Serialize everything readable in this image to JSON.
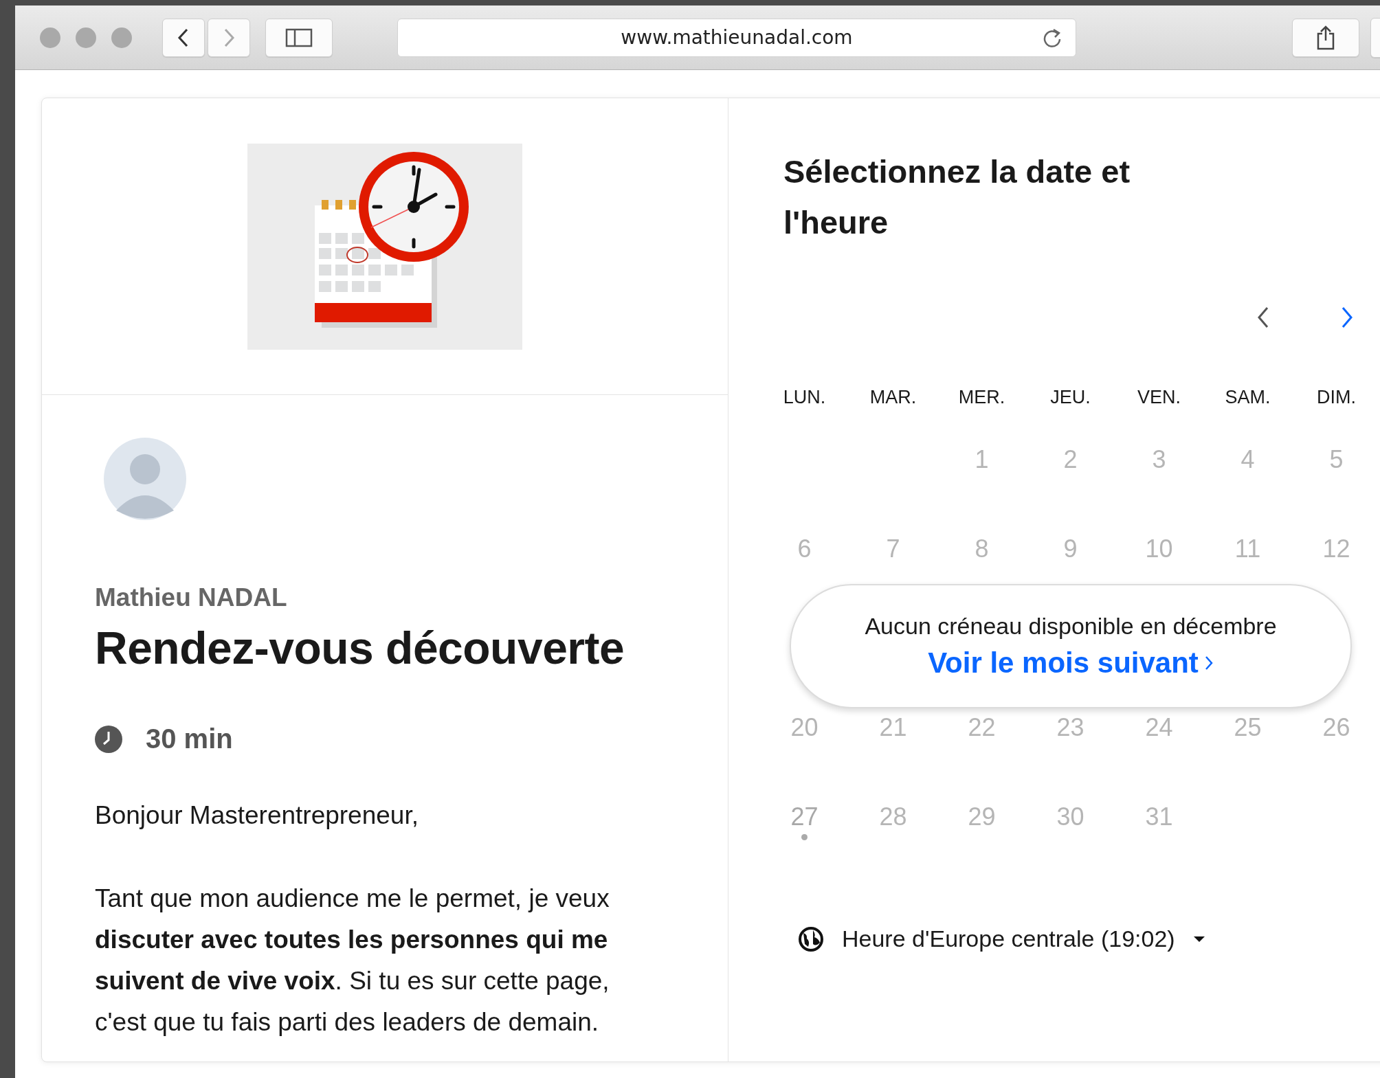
{
  "browser": {
    "address": "www.mathieunadal.com"
  },
  "event": {
    "host": "Mathieu NADAL",
    "title": "Rendez-vous découverte",
    "duration": "30 min",
    "greeting": "Bonjour Masterentrepreneur,",
    "description": "Tant que mon audience me le permet, je veux **discuter avec toutes les personnes qui me suivent de vive voix**. Si tu es sur cette page, c'est que tu fais parti des leaders de demain."
  },
  "calendar": {
    "heading": "Sélectionnez la date et l'heure",
    "prev": {
      "disabled": true
    },
    "next": {
      "disabled": false
    },
    "weekdays": [
      "LUN.",
      "MAR.",
      "MER.",
      "JEU.",
      "VEN.",
      "SAM.",
      "DIM."
    ],
    "weeks_before": [
      {
        "right_aligned": true,
        "days": [
          {
            "label": "1",
            "today": false
          },
          {
            "label": "2",
            "today": false
          },
          {
            "label": "3",
            "today": false
          },
          {
            "label": "4",
            "today": false
          },
          {
            "label": "5",
            "today": false
          }
        ]
      },
      {
        "days": [
          {
            "label": "6",
            "today": false
          },
          {
            "label": "7",
            "today": false
          },
          {
            "label": "8",
            "today": false
          },
          {
            "label": "9",
            "today": false
          },
          {
            "label": "10",
            "today": false
          },
          {
            "label": "11",
            "today": false
          },
          {
            "label": "12",
            "today": false
          }
        ]
      }
    ],
    "notice": {
      "message": "Aucun créneau disponible en décembre",
      "link": "Voir le mois suivant"
    },
    "weeks_after": [
      {
        "days": [
          {
            "label": "20",
            "today": false
          },
          {
            "label": "21",
            "today": false
          },
          {
            "label": "22",
            "today": false
          },
          {
            "label": "23",
            "today": false
          },
          {
            "label": "24",
            "today": false
          },
          {
            "label": "25",
            "today": false
          },
          {
            "label": "26",
            "today": false
          }
        ]
      },
      {
        "right_aligned": false,
        "days": [
          {
            "label": "27",
            "today": true
          },
          {
            "label": "28",
            "today": false
          },
          {
            "label": "29",
            "today": false
          },
          {
            "label": "30",
            "today": false
          },
          {
            "label": "31",
            "today": false
          }
        ]
      }
    ],
    "timezone": "Heure d'Europe centrale (19:02)"
  }
}
